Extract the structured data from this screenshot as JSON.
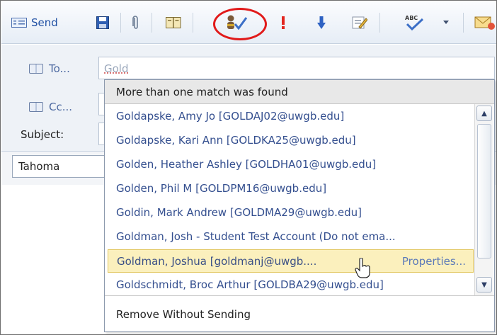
{
  "toolbar": {
    "send_label": "Send",
    "icons": [
      "send-icon",
      "save-icon",
      "attach-icon",
      "address-book-icon",
      "check-names-icon",
      "high-importance-icon",
      "low-importance-icon",
      "options-icon",
      "spell-check-icon",
      "dropdown-arrow-icon",
      "request-receipt-icon"
    ],
    "highlight_color": "#e11a1a"
  },
  "header": {
    "to_label": "To...",
    "to_value": "Gold",
    "cc_label": "Cc...",
    "subject_label": "Subject:"
  },
  "format": {
    "font_name": "Tahoma"
  },
  "dropdown": {
    "heading": "More than one match was found",
    "items": [
      "Goldapske, Amy Jo [GOLDAJ02@uwgb.edu]",
      "Goldapske, Kari Ann [GOLDKA25@uwgb.edu]",
      "Golden, Heather Ashley [GOLDHA01@uwgb.edu]",
      "Golden, Phil M [GOLDPM16@uwgb.edu]",
      "Goldin, Mark Andrew [GOLDMA29@uwgb.edu]",
      "Goldman, Josh - Student Test Account (Do not ema...",
      "Goldman, Joshua [goldmanj@uwgb....",
      "Goldschmidt, Broc Arthur [GOLDBA29@uwgb.edu]"
    ],
    "selected_properties": "Properties...",
    "footer": "Remove Without Sending"
  }
}
